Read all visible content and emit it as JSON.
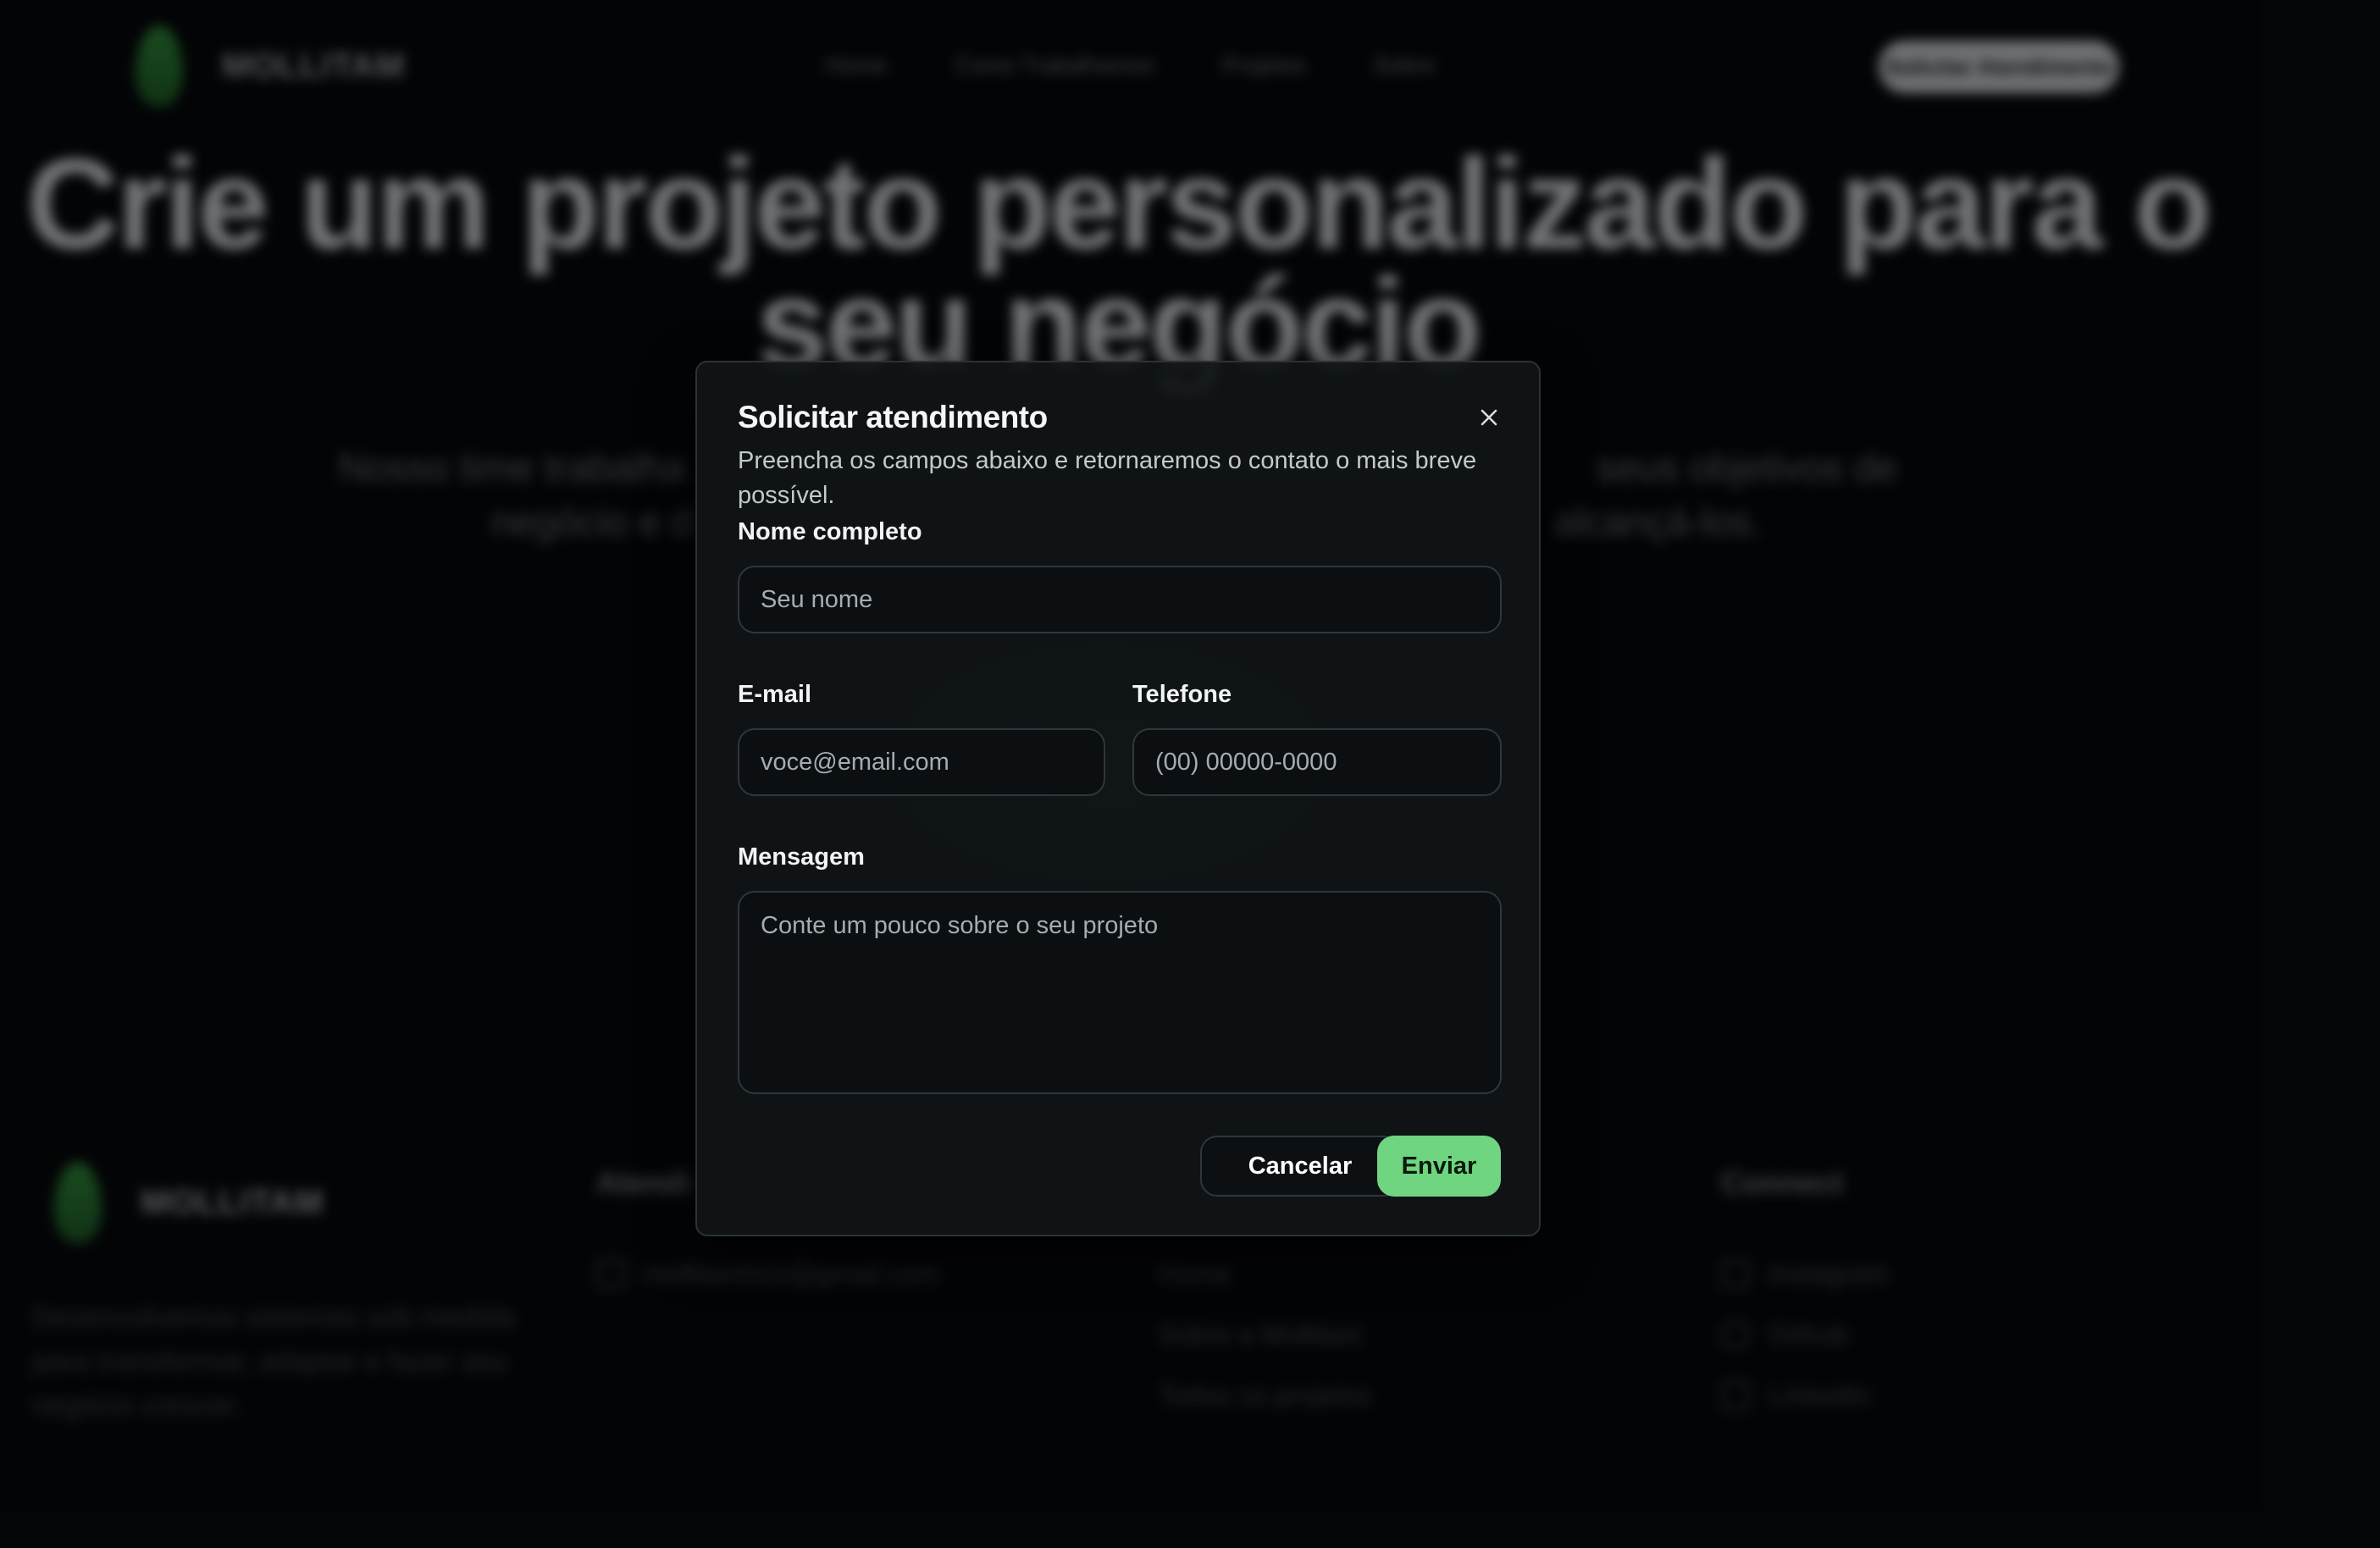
{
  "background": {
    "header": {
      "brand": "MOLLITAM",
      "nav": [
        "Home",
        "Como Trabalhamos",
        "Projetos",
        "Sobre"
      ],
      "cta_label": "Solicitar Atendimento"
    },
    "hero": {
      "title": "Crie um projeto personalizado para o seu negócio",
      "subtitle_fragments": [
        "Nosso time trabalha",
        "seus objetivos de",
        "negócio e d",
        "alcançá-los."
      ]
    },
    "footer": {
      "brand": "MOLLITAM",
      "description": "Desenvolvemos sistemas sob medida para transformar, adaptar e fazer seu negócio crescer.",
      "contact_heading_fragment": "Atendi",
      "contact_email": "mollitamhrlx@gmail.com",
      "links": [
        "Home",
        "Sobre a Mollitam",
        "Todos os projetos"
      ],
      "connect_heading": "Connect",
      "social": [
        "Instagram",
        "Github",
        "LinkedIn"
      ]
    },
    "colors": {
      "accent_glow": "#2f8a3a"
    }
  },
  "modal": {
    "title": "Solicitar atendimento",
    "description": "Preencha os campos abaixo e retornaremos o contato o mais breve possível.",
    "close_icon": "close-icon",
    "fields": {
      "name": {
        "label": "Nome completo",
        "placeholder": "Seu nome",
        "value": ""
      },
      "email": {
        "label": "E-mail",
        "placeholder": "voce@email.com",
        "value": ""
      },
      "phone": {
        "label": "Telefone",
        "placeholder": "(00) 00000-0000",
        "value": ""
      },
      "message": {
        "label": "Mensagem",
        "placeholder": "Conte um pouco sobre o seu projeto",
        "value": ""
      }
    },
    "buttons": {
      "cancel": "Cancelar",
      "submit": "Enviar"
    },
    "colors": {
      "submit_bg": "#6fd580",
      "surface": "#101417",
      "border": "#30363a"
    }
  }
}
